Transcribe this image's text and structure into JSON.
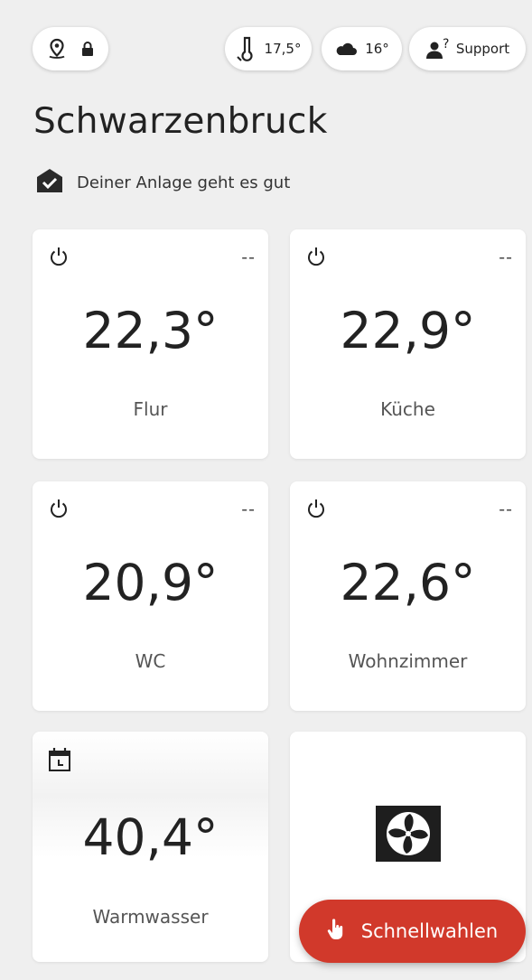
{
  "header": {
    "location_icon": "location-pin-icon",
    "lock_icon": "lock-icon",
    "outdoor_temp": "17,5°",
    "weather_temp": "16°",
    "support_label": "Support"
  },
  "site": {
    "title": "Schwarzenbruck",
    "status": "Deiner Anlage geht es gut"
  },
  "rooms": [
    {
      "temp": "22,3°",
      "name": "Flur",
      "mode": "--"
    },
    {
      "temp": "22,9°",
      "name": "Küche",
      "mode": "--"
    },
    {
      "temp": "20,9°",
      "name": "WC",
      "mode": "--"
    },
    {
      "temp": "22,6°",
      "name": "Wohnzimmer",
      "mode": "--"
    }
  ],
  "hot_water": {
    "temp": "40,4°",
    "name": "Warmwasser"
  },
  "quick_select": {
    "label": "Schnellwahlen"
  },
  "colors": {
    "accent": "#d1392b",
    "background": "#efefef",
    "card": "#ffffff"
  }
}
